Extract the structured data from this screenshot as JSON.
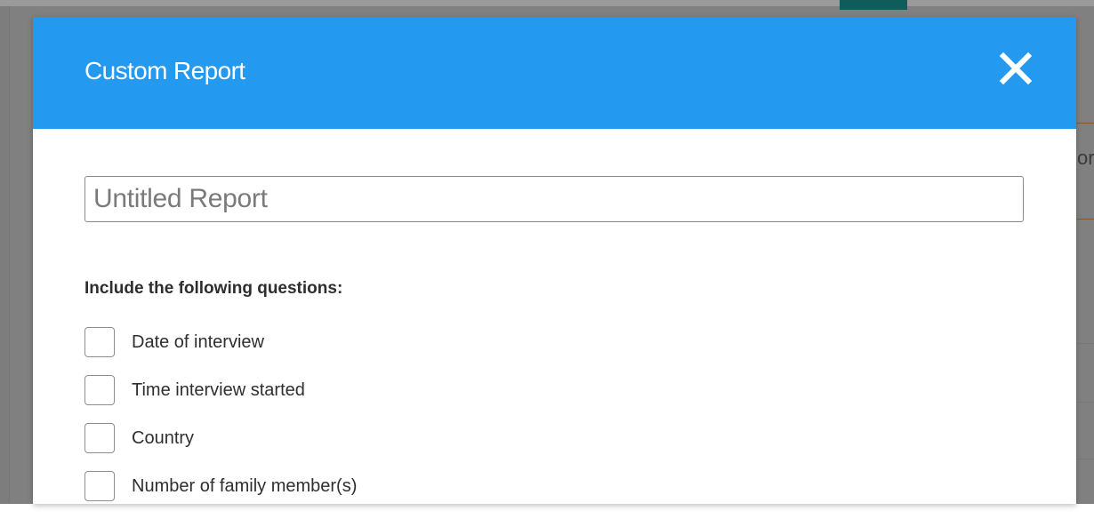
{
  "modal": {
    "title": "Custom Report",
    "close_icon": "close-icon",
    "report_name_placeholder": "Untitled Report",
    "report_name_value": "",
    "questions_heading": "Include the following questions:",
    "questions": [
      {
        "label": "Date of interview",
        "checked": false
      },
      {
        "label": "Time interview started",
        "checked": false
      },
      {
        "label": "Country",
        "checked": false
      },
      {
        "label": "Number of family member(s)",
        "checked": false
      }
    ]
  },
  "background": {
    "peek_text": "or"
  },
  "colors": {
    "header": "#2399f0",
    "header_text": "#ffffff",
    "overlay": "#808080",
    "tab_accent": "#0f5c5a"
  }
}
